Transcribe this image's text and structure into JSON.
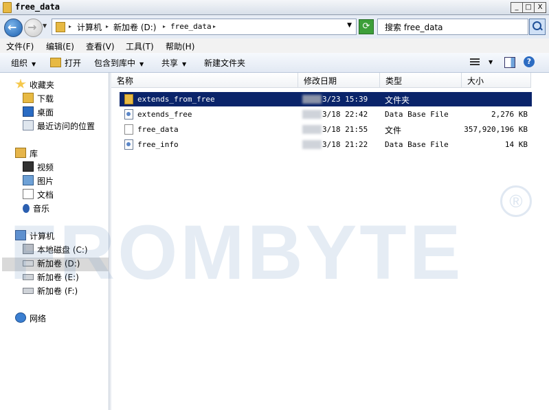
{
  "window": {
    "title": "free_data",
    "controls": {
      "minimize": "_",
      "maximize": "□",
      "close": "X"
    }
  },
  "address": {
    "segments": [
      "计算机",
      "新加卷 (D:)",
      "free_data"
    ],
    "separator": "▸",
    "search_placeholder": "搜索 free_data"
  },
  "menu": [
    "文件(F)",
    "编辑(E)",
    "查看(V)",
    "工具(T)",
    "帮助(H)"
  ],
  "toolbar": {
    "organize": "组织",
    "open": "打开",
    "include": "包含到库中",
    "share": "共享",
    "new_folder": "新建文件夹",
    "help": "?"
  },
  "sidebar": {
    "favorites": {
      "label": "收藏夹",
      "items": [
        "下载",
        "桌面",
        "最近访问的位置"
      ]
    },
    "libraries": {
      "label": "库",
      "items": [
        "视频",
        "图片",
        "文档",
        "音乐"
      ]
    },
    "computer": {
      "label": "计算机",
      "items": [
        "本地磁盘 (C:)",
        "新加卷 (D:)",
        "新加卷 (E:)",
        "新加卷 (F:)"
      ]
    },
    "network": {
      "label": "网络"
    }
  },
  "columns": [
    "名称",
    "修改日期",
    "类型",
    "大小"
  ],
  "files": [
    {
      "name": "extends_from_free",
      "date": "3/23 15:39",
      "type": "文件夹",
      "size": "",
      "icon": "folder-icon",
      "selected": true
    },
    {
      "name": "extends_free",
      "date": "3/18 22:42",
      "type": "Data Base File",
      "size": "2,276 KB",
      "icon": "database-file-icon",
      "selected": false
    },
    {
      "name": "free_data",
      "date": "3/18 21:55",
      "type": "文件",
      "size": "357,920,196 KB",
      "icon": "file-icon",
      "selected": false
    },
    {
      "name": "free_info",
      "date": "3/18 21:22",
      "type": "Data Base File",
      "size": "14 KB",
      "icon": "database-file-icon",
      "selected": false
    }
  ],
  "watermark": {
    "text": "FROMBYTE",
    "mark": "®"
  },
  "colors": {
    "selection": "#0a246a",
    "titlebar": "#e3e9f1",
    "sidebar_selected": "#d9d9d9"
  }
}
